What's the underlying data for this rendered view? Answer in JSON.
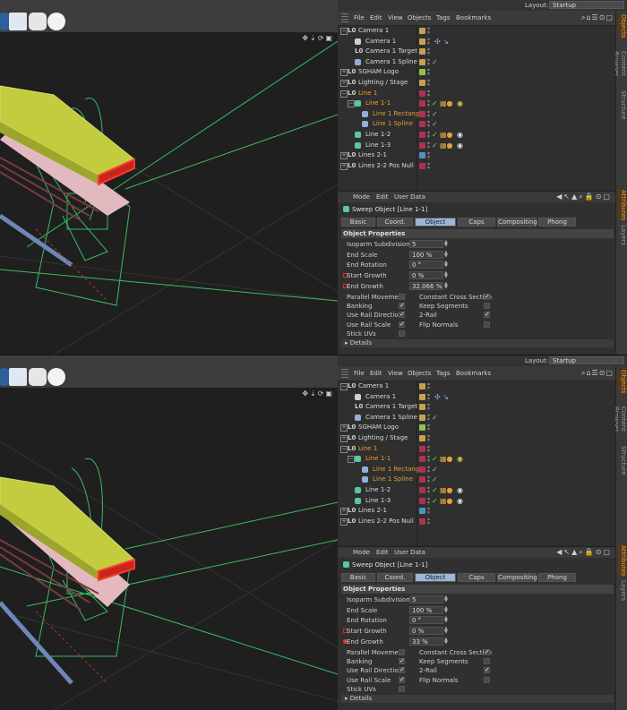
{
  "layout": {
    "label": "Layout:",
    "value": "Startup"
  },
  "side_tabs": [
    "Objects",
    "Content Browser",
    "Structure",
    "Attributes",
    "Layers"
  ],
  "object_manager": {
    "menus": [
      "File",
      "Edit",
      "View",
      "Objects",
      "Tags",
      "Bookmarks"
    ],
    "rows": [
      {
        "name": "Camera 1",
        "indent": 0,
        "icon": "null-icon",
        "layer": "#c8a050",
        "state": "normal"
      },
      {
        "name": "Camera 1",
        "indent": 1,
        "icon": "camera-icon",
        "layer": "#c8a050",
        "state": "normal"
      },
      {
        "name": "Camera 1 Target",
        "indent": 1,
        "icon": "null-icon",
        "layer": "#c8a050",
        "state": "normal"
      },
      {
        "name": "Camera 1 Spline",
        "indent": 1,
        "icon": "spline-icon",
        "layer": "#c8a050",
        "state": "normal"
      },
      {
        "name": "SGHAM Logo",
        "indent": 0,
        "icon": "null-icon",
        "layer": "#8fc050",
        "state": "normal"
      },
      {
        "name": "Lighting / Stage",
        "indent": 0,
        "icon": "null-icon",
        "layer": "#c8a050",
        "state": "normal"
      },
      {
        "name": "Line 1",
        "indent": 0,
        "icon": "null-icon",
        "layer": "#b03050",
        "state": "selected"
      },
      {
        "name": "Line 1-1",
        "indent": 1,
        "icon": "sweep-icon",
        "layer": "#b03050",
        "state": "selected"
      },
      {
        "name": "Line 1 Rectangle",
        "indent": 2,
        "icon": "rectangle-icon",
        "layer": "#b03050",
        "state": "child"
      },
      {
        "name": "Line 1 Spline",
        "indent": 2,
        "icon": "spline-icon",
        "layer": "#b03050",
        "state": "child"
      },
      {
        "name": "Line 1-2",
        "indent": 1,
        "icon": "sweep-icon",
        "layer": "#b03050",
        "state": "normal"
      },
      {
        "name": "Line 1-3",
        "indent": 1,
        "icon": "sweep-icon",
        "layer": "#b03050",
        "state": "normal"
      },
      {
        "name": "Lines 2-1",
        "indent": 0,
        "icon": "null-icon",
        "layer": "#5090c8",
        "state": "normal"
      },
      {
        "name": "Lines 2-2 Pos Null",
        "indent": 0,
        "icon": "null-icon",
        "layer": "#b03050",
        "state": "normal"
      }
    ]
  },
  "attributes": {
    "menus": [
      "Mode",
      "Edit",
      "User Data"
    ],
    "title": "Sweep Object [Line 1-1]",
    "tabs": [
      "Basic",
      "Coord.",
      "Object",
      "Caps",
      "Compositing",
      "Phong"
    ],
    "active_tab": "Object",
    "section": "Object Properties",
    "details": "Details",
    "checks": [
      {
        "label": "Parallel Movement",
        "checked": false
      },
      {
        "label": "Constant Cross Section",
        "checked": true
      },
      {
        "label": "Banking",
        "checked": true
      },
      {
        "label": "Keep Segments",
        "checked": false
      },
      {
        "label": "Use Rail Direction",
        "checked": true
      },
      {
        "label": "2-Rail",
        "checked": true
      },
      {
        "label": "Use Rail Scale",
        "checked": true
      },
      {
        "label": "Flip Normals",
        "checked": false
      },
      {
        "label": "Stick UVs",
        "checked": false
      }
    ]
  },
  "panels": [
    {
      "fields": [
        {
          "label": "Isoparm Subdivision",
          "value": "5"
        },
        {
          "label": "End Scale",
          "value": "100 %"
        },
        {
          "label": "End Rotation",
          "value": "0 °"
        },
        {
          "label": "Start Growth",
          "value": "0 %"
        },
        {
          "label": "End Growth",
          "value": "32.066 %"
        }
      ]
    },
    {
      "fields": [
        {
          "label": "Isoparm Subdivision",
          "value": "5"
        },
        {
          "label": "End Scale",
          "value": "100 %"
        },
        {
          "label": "End Rotation",
          "value": "0 °"
        },
        {
          "label": "Start Growth",
          "value": "0 %"
        },
        {
          "label": "End Growth",
          "value": "33 %"
        }
      ]
    }
  ]
}
